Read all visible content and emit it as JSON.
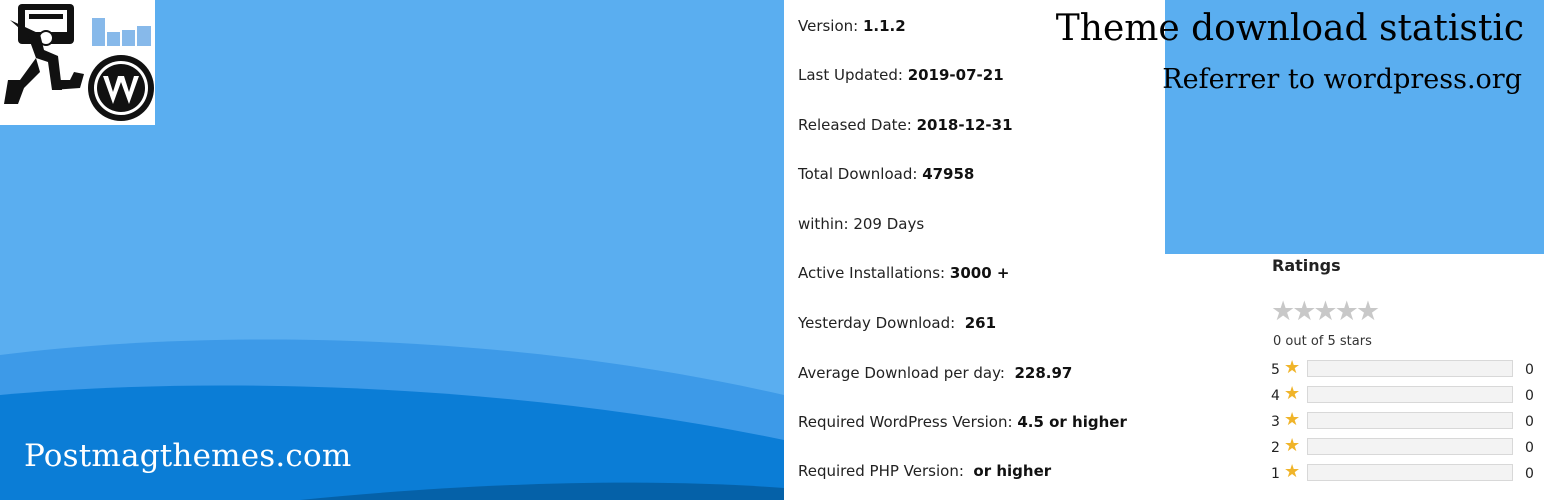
{
  "banner": {
    "site_name": "Postmagthemes.com",
    "colors": {
      "background": "#5aaef0",
      "wave_light": "#3d9ae8",
      "wave_dark": "#0b7dd6",
      "wave_deep": "#0561a8"
    },
    "logo_icons": [
      "runner-computer-icon",
      "bar-chart-icon",
      "wordpress-logo-icon"
    ]
  },
  "header": {
    "title": "Theme download statistic",
    "subtitle": "Referrer to wordpress.org"
  },
  "stats": [
    {
      "label": "Version: ",
      "value": "1.1.2"
    },
    {
      "label": "Last Updated: ",
      "value": "2019-07-21"
    },
    {
      "label": "Released Date: ",
      "value": "2018-12-31"
    },
    {
      "label": "Total Download: ",
      "value": "47958"
    },
    {
      "label": "within: 209 Days",
      "value": ""
    },
    {
      "label": "Active Installations: ",
      "value": "3000 +"
    },
    {
      "label": "Yesterday Download:  ",
      "value": "261"
    },
    {
      "label": "Average Download per day:  ",
      "value": "228.97"
    },
    {
      "label": "Required WordPress Version: ",
      "value": "4.5 or higher"
    },
    {
      "label": "Required PHP Version:  ",
      "value": "or higher"
    }
  ],
  "ratings": {
    "title": "Ratings",
    "stars_glyph": "★★★★★",
    "caption": "0 out of 5 stars",
    "star_color": "#f0b429",
    "rows": [
      {
        "stars": "5",
        "count": "0",
        "fraction": 0
      },
      {
        "stars": "4",
        "count": "0",
        "fraction": 0
      },
      {
        "stars": "3",
        "count": "0",
        "fraction": 0
      },
      {
        "stars": "2",
        "count": "0",
        "fraction": 0
      },
      {
        "stars": "1",
        "count": "0",
        "fraction": 0
      }
    ]
  }
}
